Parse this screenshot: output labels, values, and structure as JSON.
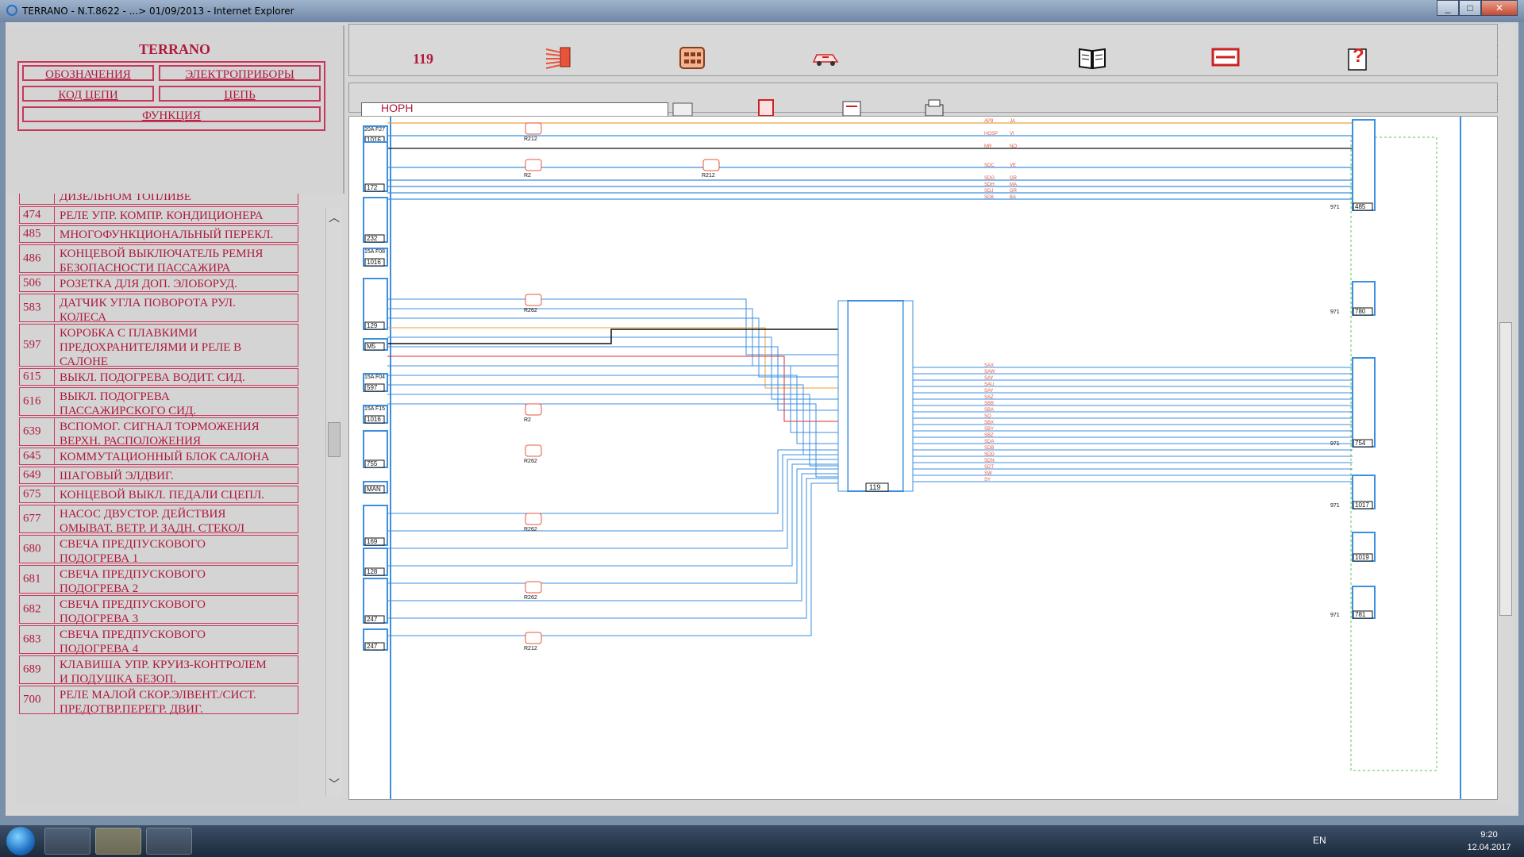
{
  "window": {
    "title": "TERRANO - N.T.8622 - ...> 01/09/2013 - Internet Explorer"
  },
  "left_pane": {
    "title": "TERRANO",
    "nav": {
      "designations": "ОБОЗНАЧЕНИЯ",
      "electrical_devices": "ЭЛЕКТРОПРИБОРЫ",
      "circuit_code": "КОД ЦЕПИ",
      "circuit": "ЦЕПЬ",
      "function": "ФУНКЦИЯ"
    },
    "partial_item": "ДИЗЕЛЬНОМ ТОПЛИВЕ",
    "items": [
      {
        "code": "474",
        "label": "РЕЛЕ УПР. КОМПР. КОНДИЦИОНЕРА"
      },
      {
        "code": "485",
        "label": "МНОГОФУНКЦИОНАЛЬНЫЙ ПЕРЕКЛ."
      },
      {
        "code": "486",
        "label": "КОНЦЕВОЙ ВЫКЛЮЧАТЕЛЬ РЕМНЯ\nБЕЗОПАСНОСТИ ПАССАЖИРА"
      },
      {
        "code": "506",
        "label": "РОЗЕТКА ДЛЯ ДОП. ЭЛОБОРУД."
      },
      {
        "code": "583",
        "label": "ДАТЧИК УГЛА ПОВОРОТА РУЛ.\nКОЛЕСА"
      },
      {
        "code": "597",
        "label": "КОРОБКА С ПЛАВКИМИ\nПРЕДОХРАНИТЕЛЯМИ И РЕЛЕ В\nСАЛОНЕ"
      },
      {
        "code": "615",
        "label": "ВЫКЛ. ПОДОГРЕВА ВОДИТ. СИД."
      },
      {
        "code": "616",
        "label": "ВЫКЛ. ПОДОГРЕВА\nПАССАЖИРСКОГО СИД."
      },
      {
        "code": "639",
        "label": "ВСПОМОГ. СИГНАЛ ТОРМОЖЕНИЯ\nВЕРХН. РАСПОЛОЖЕНИЯ"
      },
      {
        "code": "645",
        "label": "КОММУТАЦИОННЫЙ БЛОК САЛОНА"
      },
      {
        "code": "649",
        "label": "ШАГОВЫЙ ЭЛДВИГ."
      },
      {
        "code": "675",
        "label": "КОНЦЕВОЙ ВЫКЛ. ПЕДАЛИ СЦЕПЛ."
      },
      {
        "code": "677",
        "label": "НАСОС ДВУСТОР. ДЕЙСТВИЯ\nОМЫВАТ. ВЕТР. И ЗАДН. СТЕКОЛ"
      },
      {
        "code": "680",
        "label": "СВЕЧА ПРЕДПУСКОВОГО\nПОДОГРЕВА 1"
      },
      {
        "code": "681",
        "label": "СВЕЧА ПРЕДПУСКОВОГО\nПОДОГРЕВА 2"
      },
      {
        "code": "682",
        "label": "СВЕЧА ПРЕДПУСКОВОГО\nПОДОГРЕВА 3"
      },
      {
        "code": "683",
        "label": "СВЕЧА ПРЕДПУСКОВОГО\nПОДОГРЕВА 4"
      },
      {
        "code": "689",
        "label": "КЛАВИША УПР. КРУИЗ-КОНТРОЛЕМ\nИ ПОДУШКА БЕЗОП."
      },
      {
        "code": "700",
        "label": "РЕЛЕ МАЛОЙ СКОР.ЭЛВЕНТ./СИСТ.\nПРЕДОТВР.ПЕРЕГР. ДВИГ."
      }
    ]
  },
  "toolbar": {
    "page_number": "119",
    "icons": [
      "harness-icon",
      "connector-icon",
      "vehicle-location-icon",
      "book-icon",
      "fuse-icon",
      "help-icon"
    ],
    "dropdown_value": "НОРН",
    "second_row_icons": [
      "dropdown-tool-icon",
      "component-icon",
      "notes-icon",
      "print-icon"
    ]
  },
  "diagram": {
    "central_unit": "119",
    "components_left": [
      {
        "id": "1016",
        "fuse": "20A F27"
      },
      {
        "id": "172"
      },
      {
        "id": "232"
      },
      {
        "id": "1016",
        "fuse": "15A F08"
      },
      {
        "id": "129"
      },
      {
        "id": "M5"
      },
      {
        "id": "597",
        "fuse": "15A F04"
      },
      {
        "id": "1016",
        "fuse": "15A F15"
      },
      {
        "id": "755"
      },
      {
        "id": "MAN"
      },
      {
        "id": "169"
      },
      {
        "id": "128"
      },
      {
        "id": "247"
      },
      {
        "id": "247"
      }
    ],
    "components_right": [
      {
        "id": "485",
        "label": "971"
      },
      {
        "id": "780",
        "label": "971"
      },
      {
        "id": "754",
        "label": "971"
      },
      {
        "id": "1017",
        "label": "971"
      },
      {
        "id": "1019"
      },
      {
        "id": "781",
        "label": "971"
      }
    ],
    "connectors": [
      "R212",
      "R2",
      "R212",
      "R262",
      "R2",
      "R262",
      "R262",
      "R262",
      "R212"
    ],
    "wires_top": [
      {
        "code": "AP9",
        "color": "JA"
      },
      {
        "code": "HGSP",
        "color": "VI"
      },
      {
        "code": "MR",
        "color": "NO"
      },
      {
        "code": "SDC",
        "color": "VE"
      },
      {
        "code": "SDG",
        "color": "GR"
      },
      {
        "code": "SDH",
        "color": "MA"
      },
      {
        "code": "SDJ",
        "color": "GR"
      },
      {
        "code": "SDK",
        "color": "BA"
      }
    ],
    "wires_right": [
      "SAX",
      "SAW",
      "SAY",
      "SAU",
      "SAY",
      "SAZ",
      "SBB",
      "SBA",
      "SQ",
      "SBX",
      "SBY",
      "SBZ",
      "SDA",
      "SDB",
      "SDD",
      "SDN",
      "SDT",
      "SW",
      "SY"
    ],
    "wire_colors": {
      "orange": "#e8a23a",
      "blue": "#3b8fe0",
      "red": "#e02a2a",
      "black": "#111111"
    }
  },
  "taskbar": {
    "language": "EN",
    "time": "9:20",
    "date": "12.04.2017"
  }
}
